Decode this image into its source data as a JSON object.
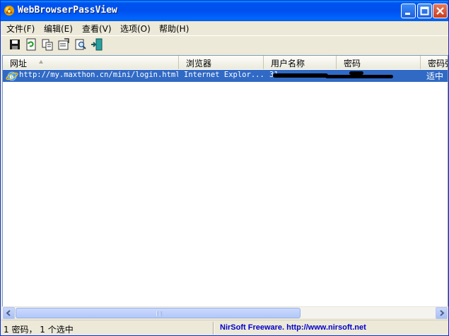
{
  "window": {
    "title": "WebBrowserPassView"
  },
  "menu": {
    "items": [
      {
        "label": "文件(F)"
      },
      {
        "label": "编辑(E)"
      },
      {
        "label": "查看(V)"
      },
      {
        "label": "选项(O)"
      },
      {
        "label": "帮助(H)"
      }
    ]
  },
  "toolbar": {
    "icons": [
      "save-icon",
      "refresh-icon",
      "copy-icon",
      "properties-icon",
      "find-icon",
      "exit-icon"
    ]
  },
  "list": {
    "columns": [
      {
        "label": "网址"
      },
      {
        "label": "浏览器"
      },
      {
        "label": "用户名称"
      },
      {
        "label": "密码"
      },
      {
        "label": "密码强"
      }
    ],
    "rows": [
      {
        "url": "http://my.maxthon.cn/mini/login.html",
        "browser": "Internet Explor...",
        "username": "31",
        "password": "",
        "strength": "适中"
      }
    ]
  },
  "status": {
    "count_text": "1 密码， 1 个选中",
    "credit_text": "NirSoft Freeware.  http://www.nirsoft.net"
  },
  "colors": {
    "selection": "#316ac5",
    "titlebar": "#0050ee",
    "credit_link": "#0000cc"
  }
}
